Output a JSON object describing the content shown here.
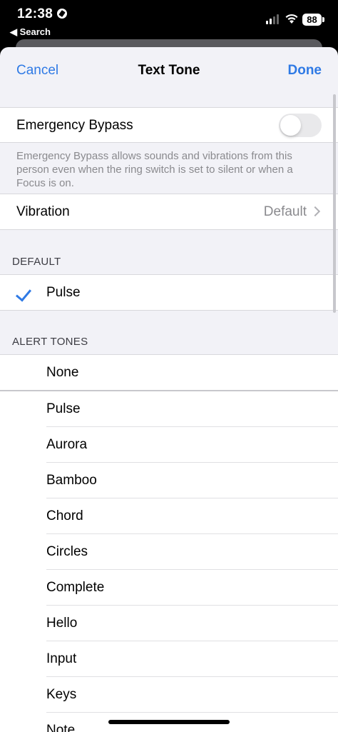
{
  "status_bar": {
    "time": "12:38",
    "back_label": "◀ Search",
    "battery": "88"
  },
  "nav": {
    "cancel": "Cancel",
    "title": "Text Tone",
    "done": "Done"
  },
  "emergency_bypass": {
    "label": "Emergency Bypass",
    "enabled": false,
    "footnote": "Emergency Bypass allows sounds and vibrations from this person even when the ring switch is set to silent or when a Focus is on."
  },
  "vibration": {
    "label": "Vibration",
    "value": "Default"
  },
  "default_section": {
    "header": "DEFAULT",
    "selected_tone": "Pulse"
  },
  "alert_tones": {
    "header": "ALERT TONES",
    "items": [
      "None",
      "Pulse",
      "Aurora",
      "Bamboo",
      "Chord",
      "Circles",
      "Complete",
      "Hello",
      "Input",
      "Keys",
      "Note"
    ]
  },
  "colors": {
    "accent": "#2f7ae5",
    "secondary_text": "#8a8a8e",
    "background": "#f2f2f7"
  }
}
